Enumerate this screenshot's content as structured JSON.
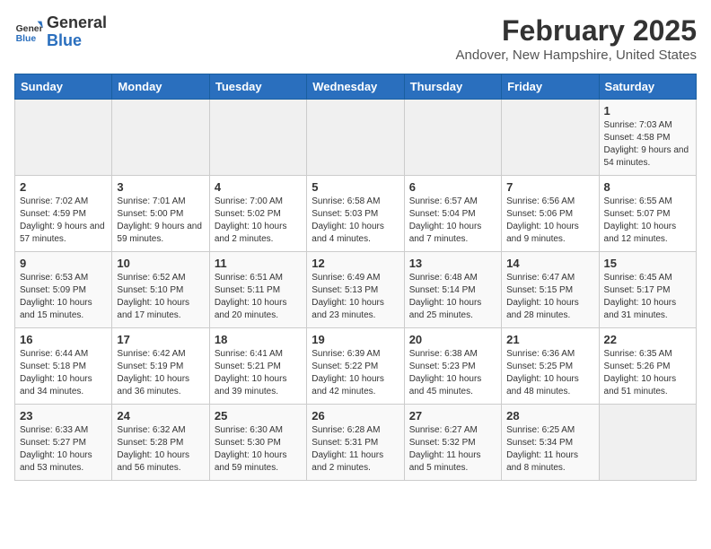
{
  "logo": {
    "text_general": "General",
    "text_blue": "Blue"
  },
  "header": {
    "title": "February 2025",
    "subtitle": "Andover, New Hampshire, United States"
  },
  "weekdays": [
    "Sunday",
    "Monday",
    "Tuesday",
    "Wednesday",
    "Thursday",
    "Friday",
    "Saturday"
  ],
  "weeks": [
    [
      {
        "day": "",
        "info": ""
      },
      {
        "day": "",
        "info": ""
      },
      {
        "day": "",
        "info": ""
      },
      {
        "day": "",
        "info": ""
      },
      {
        "day": "",
        "info": ""
      },
      {
        "day": "",
        "info": ""
      },
      {
        "day": "1",
        "info": "Sunrise: 7:03 AM\nSunset: 4:58 PM\nDaylight: 9 hours and 54 minutes."
      }
    ],
    [
      {
        "day": "2",
        "info": "Sunrise: 7:02 AM\nSunset: 4:59 PM\nDaylight: 9 hours and 57 minutes."
      },
      {
        "day": "3",
        "info": "Sunrise: 7:01 AM\nSunset: 5:00 PM\nDaylight: 9 hours and 59 minutes."
      },
      {
        "day": "4",
        "info": "Sunrise: 7:00 AM\nSunset: 5:02 PM\nDaylight: 10 hours and 2 minutes."
      },
      {
        "day": "5",
        "info": "Sunrise: 6:58 AM\nSunset: 5:03 PM\nDaylight: 10 hours and 4 minutes."
      },
      {
        "day": "6",
        "info": "Sunrise: 6:57 AM\nSunset: 5:04 PM\nDaylight: 10 hours and 7 minutes."
      },
      {
        "day": "7",
        "info": "Sunrise: 6:56 AM\nSunset: 5:06 PM\nDaylight: 10 hours and 9 minutes."
      },
      {
        "day": "8",
        "info": "Sunrise: 6:55 AM\nSunset: 5:07 PM\nDaylight: 10 hours and 12 minutes."
      }
    ],
    [
      {
        "day": "9",
        "info": "Sunrise: 6:53 AM\nSunset: 5:09 PM\nDaylight: 10 hours and 15 minutes."
      },
      {
        "day": "10",
        "info": "Sunrise: 6:52 AM\nSunset: 5:10 PM\nDaylight: 10 hours and 17 minutes."
      },
      {
        "day": "11",
        "info": "Sunrise: 6:51 AM\nSunset: 5:11 PM\nDaylight: 10 hours and 20 minutes."
      },
      {
        "day": "12",
        "info": "Sunrise: 6:49 AM\nSunset: 5:13 PM\nDaylight: 10 hours and 23 minutes."
      },
      {
        "day": "13",
        "info": "Sunrise: 6:48 AM\nSunset: 5:14 PM\nDaylight: 10 hours and 25 minutes."
      },
      {
        "day": "14",
        "info": "Sunrise: 6:47 AM\nSunset: 5:15 PM\nDaylight: 10 hours and 28 minutes."
      },
      {
        "day": "15",
        "info": "Sunrise: 6:45 AM\nSunset: 5:17 PM\nDaylight: 10 hours and 31 minutes."
      }
    ],
    [
      {
        "day": "16",
        "info": "Sunrise: 6:44 AM\nSunset: 5:18 PM\nDaylight: 10 hours and 34 minutes."
      },
      {
        "day": "17",
        "info": "Sunrise: 6:42 AM\nSunset: 5:19 PM\nDaylight: 10 hours and 36 minutes."
      },
      {
        "day": "18",
        "info": "Sunrise: 6:41 AM\nSunset: 5:21 PM\nDaylight: 10 hours and 39 minutes."
      },
      {
        "day": "19",
        "info": "Sunrise: 6:39 AM\nSunset: 5:22 PM\nDaylight: 10 hours and 42 minutes."
      },
      {
        "day": "20",
        "info": "Sunrise: 6:38 AM\nSunset: 5:23 PM\nDaylight: 10 hours and 45 minutes."
      },
      {
        "day": "21",
        "info": "Sunrise: 6:36 AM\nSunset: 5:25 PM\nDaylight: 10 hours and 48 minutes."
      },
      {
        "day": "22",
        "info": "Sunrise: 6:35 AM\nSunset: 5:26 PM\nDaylight: 10 hours and 51 minutes."
      }
    ],
    [
      {
        "day": "23",
        "info": "Sunrise: 6:33 AM\nSunset: 5:27 PM\nDaylight: 10 hours and 53 minutes."
      },
      {
        "day": "24",
        "info": "Sunrise: 6:32 AM\nSunset: 5:28 PM\nDaylight: 10 hours and 56 minutes."
      },
      {
        "day": "25",
        "info": "Sunrise: 6:30 AM\nSunset: 5:30 PM\nDaylight: 10 hours and 59 minutes."
      },
      {
        "day": "26",
        "info": "Sunrise: 6:28 AM\nSunset: 5:31 PM\nDaylight: 11 hours and 2 minutes."
      },
      {
        "day": "27",
        "info": "Sunrise: 6:27 AM\nSunset: 5:32 PM\nDaylight: 11 hours and 5 minutes."
      },
      {
        "day": "28",
        "info": "Sunrise: 6:25 AM\nSunset: 5:34 PM\nDaylight: 11 hours and 8 minutes."
      },
      {
        "day": "",
        "info": ""
      }
    ]
  ]
}
